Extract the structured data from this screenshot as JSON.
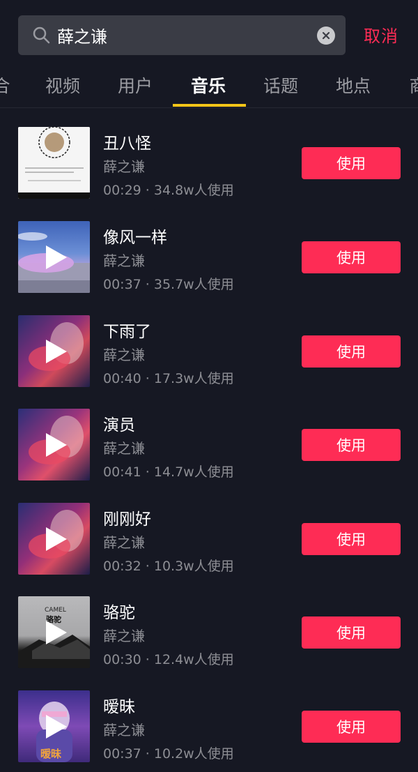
{
  "search": {
    "query": "薛之谦",
    "cancel_label": "取消"
  },
  "tabs": [
    {
      "label": "合"
    },
    {
      "label": "视频"
    },
    {
      "label": "用户"
    },
    {
      "label": "音乐"
    },
    {
      "label": "话题"
    },
    {
      "label": "地点"
    },
    {
      "label": "商"
    }
  ],
  "active_tab": "音乐",
  "colors": {
    "accent": "#fe2c55",
    "tab_indicator": "#f5c518",
    "background": "#161823"
  },
  "results": [
    {
      "title": "丑八怪",
      "artist": "薛之谦",
      "meta": "00:29 · 34.8w人使用",
      "button": "使用"
    },
    {
      "title": "像风一样",
      "artist": "薛之谦",
      "meta": "00:37 · 35.7w人使用",
      "button": "使用"
    },
    {
      "title": "下雨了",
      "artist": "薛之谦",
      "meta": "00:40 · 17.3w人使用",
      "button": "使用"
    },
    {
      "title": "演员",
      "artist": "薛之谦",
      "meta": "00:41 · 14.7w人使用",
      "button": "使用"
    },
    {
      "title": "刚刚好",
      "artist": "薛之谦",
      "meta": "00:32 · 10.3w人使用",
      "button": "使用"
    },
    {
      "title": "骆驼",
      "artist": "薛之谦",
      "meta": "00:30 · 12.4w人使用",
      "button": "使用"
    },
    {
      "title": "暧昧",
      "artist": "薛之谦",
      "meta": "00:37 · 10.2w人使用",
      "button": "使用"
    }
  ],
  "cover_text": {
    "camel_en": "CAMEL",
    "camel_cn": "骆驼",
    "aimei_cn": "暧昧"
  },
  "icons": {
    "search": "search-icon",
    "clear": "close-circle-icon",
    "play": "play-icon"
  }
}
